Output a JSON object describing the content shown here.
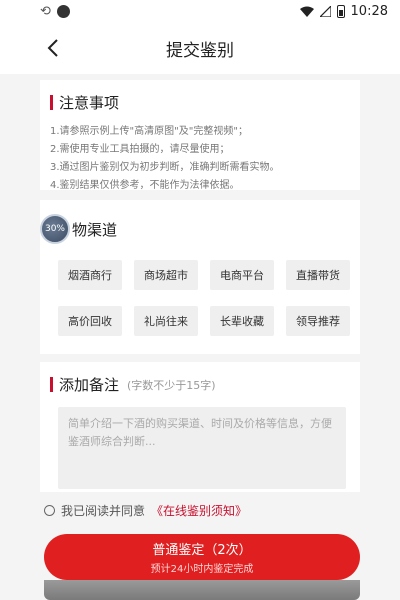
{
  "status_bar": {
    "time": "10:28"
  },
  "nav": {
    "title": "提交鉴别"
  },
  "notice": {
    "title": "注意事项",
    "items": [
      "1.请参照示例上传\"高清原图\"及\"完整视频\"；",
      "2.需使用专业工具拍摄的，请尽量使用；",
      "3.通过图片鉴别仅为初步判断，准确判断需看实物。",
      "4.鉴别结果仅供参考，不能作为法律依据。"
    ]
  },
  "channel": {
    "loading_badge": "30%",
    "title": "物渠道",
    "tags": [
      "烟酒商行",
      "商场超市",
      "电商平台",
      "直播带货",
      "高价回收",
      "礼尚往来",
      "长辈收藏",
      "领导推荐"
    ]
  },
  "remark": {
    "title": "添加备注",
    "hint": "(字数不少于15字)",
    "placeholder": "简单介绍一下酒的购买渠道、时间及价格等信息，方便鉴酒师综合判断..."
  },
  "agree": {
    "prefix": "我已阅读并同意",
    "link": "《在线鉴别须知》"
  },
  "submit": {
    "label": "普通鉴定（2次）",
    "sub_label": "预计24小时内鉴定完成"
  },
  "colors": {
    "accent": "#c8102e",
    "button": "#e02020"
  }
}
